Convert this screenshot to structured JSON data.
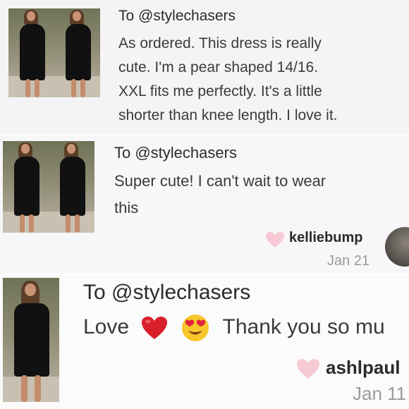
{
  "comments": [
    {
      "to": "To @stylechasers",
      "lines": [
        "As ordered. This dress is really",
        "cute. I'm a pear shaped 14/16.",
        "XXL fits me perfectly. It's a little",
        "shorter than knee length. I love it."
      ]
    },
    {
      "to": "To @stylechasers",
      "lines": [
        "Super cute! I can't wait to wear",
        "this"
      ],
      "username": "kelliebump",
      "date": "Jan 21"
    },
    {
      "to": "To @stylechasers",
      "text_before": "Love",
      "text_after": "Thank you so mu",
      "username": "ashlpaul",
      "date": "Jan 11"
    }
  ],
  "icons": {
    "like": "heart-icon",
    "red_heart": "red-heart-emoji",
    "heart_eyes": "heart-eyes-emoji"
  },
  "colors": {
    "like_heart": "#f6c9d4",
    "red_heart": "#d91f2a",
    "date_text": "#9a9a9a"
  }
}
